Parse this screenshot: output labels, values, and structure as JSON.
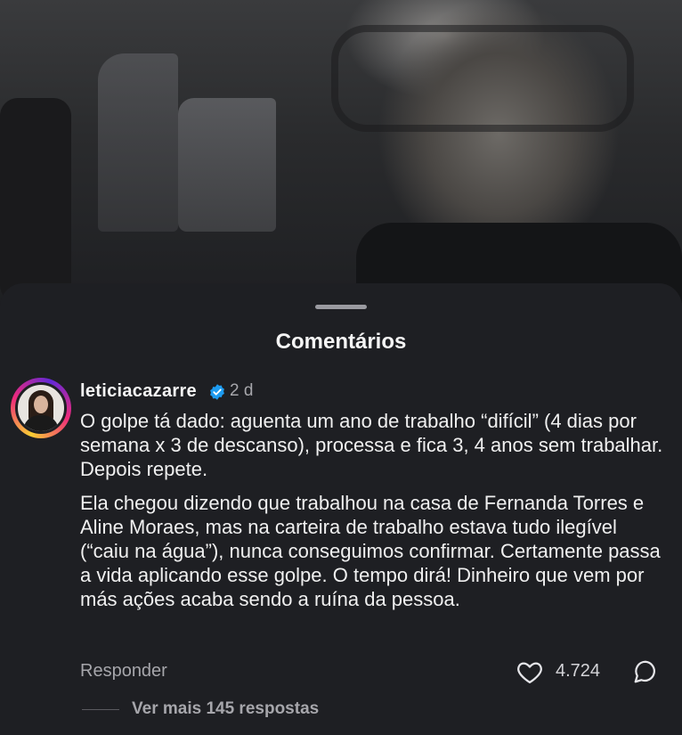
{
  "sheet": {
    "title": "Comentários"
  },
  "comment": {
    "username": "leticiacazarre",
    "verified": true,
    "time": "2 d",
    "paragraphs": [
      "O golpe tá dado: aguenta um ano de trabalho “difícil” (4 dias por semana x 3 de descanso), processa e fica 3, 4 anos sem trabalhar. Depois repete.",
      "Ela chegou dizendo que trabalhou na casa de Fernanda Torres e Aline Moraes, mas na carteira de trabalho estava tudo ilegível (“caiu na água”), nunca conseguimos confirmar. Certamente passa a vida aplicando esse golpe. O tempo dirá! Dinheiro que vem por más ações acaba sendo a ruína da pessoa."
    ],
    "reply_label": "Responder",
    "likes": "4.724",
    "more_replies": "Ver mais 145 respostas"
  },
  "icons": {
    "verified": "verified-badge-icon",
    "like": "heart-icon",
    "reply": "reply-bubble-icon"
  },
  "colors": {
    "background": "#1e1f23",
    "verified": "#1d9bf0",
    "muted_text": "#a6a6ab"
  }
}
